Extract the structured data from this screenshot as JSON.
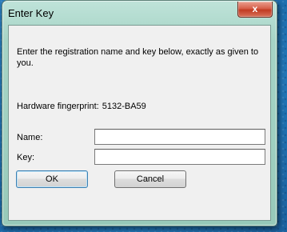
{
  "dialog": {
    "title": "Enter Key",
    "close_glyph": "x",
    "close_icon": "close-icon",
    "instructions": "Enter the registration name and key below, exactly as given to you.",
    "fingerprint_label": "Hardware fingerprint:",
    "fingerprint_value": "5132-BA59",
    "name_label": "Name:",
    "name_value": "",
    "key_label": "Key:",
    "key_value": "",
    "ok_label": "OK",
    "cancel_label": "Cancel"
  },
  "colors": {
    "desktop": "#1f6faf",
    "frame": "#a6d4c6",
    "client": "#f0f0f0",
    "close_button": "#c13b22"
  }
}
